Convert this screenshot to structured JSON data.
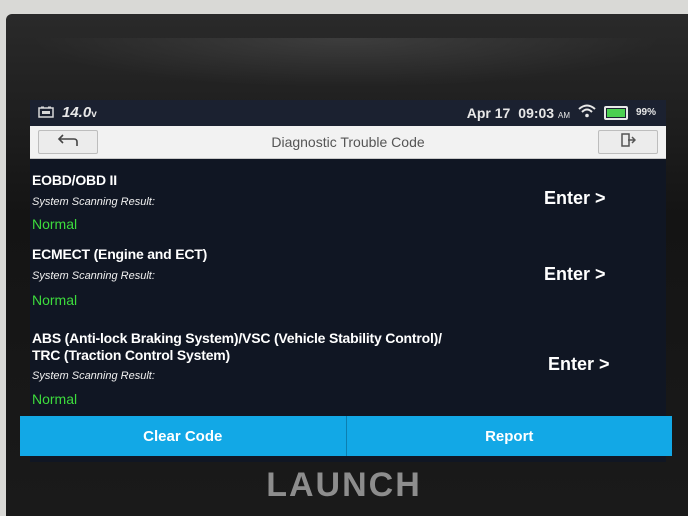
{
  "status_bar": {
    "voltage": "14.0",
    "voltage_unit": "v",
    "date": "Apr 17",
    "time": "09:03",
    "ampm": "AM",
    "battery": "99%"
  },
  "title_bar": {
    "title": "Diagnostic Trouble Code"
  },
  "systems": [
    {
      "name_lines": [
        "EOBD/OBD II"
      ],
      "result_label": "System Scanning Result:",
      "status": "Normal",
      "action": "Enter >"
    },
    {
      "name_lines": [
        "ECMECT (Engine and ECT)"
      ],
      "result_label": "System Scanning Result:",
      "status": "Normal",
      "action": "Enter >"
    },
    {
      "name_lines": [
        "ABS (Anti-lock Braking System)/VSC (Vehicle Stability Control)/",
        "TRC (Traction Control System)"
      ],
      "result_label": "System Scanning Result:",
      "status": "Normal",
      "action": "Enter >"
    }
  ],
  "bottom_bar": {
    "clear_code": "Clear Code",
    "report": "Report"
  },
  "brand": "LAUNCH",
  "colors": {
    "accent_blue": "#12a8e6",
    "status_normal": "#3ddc3d"
  }
}
